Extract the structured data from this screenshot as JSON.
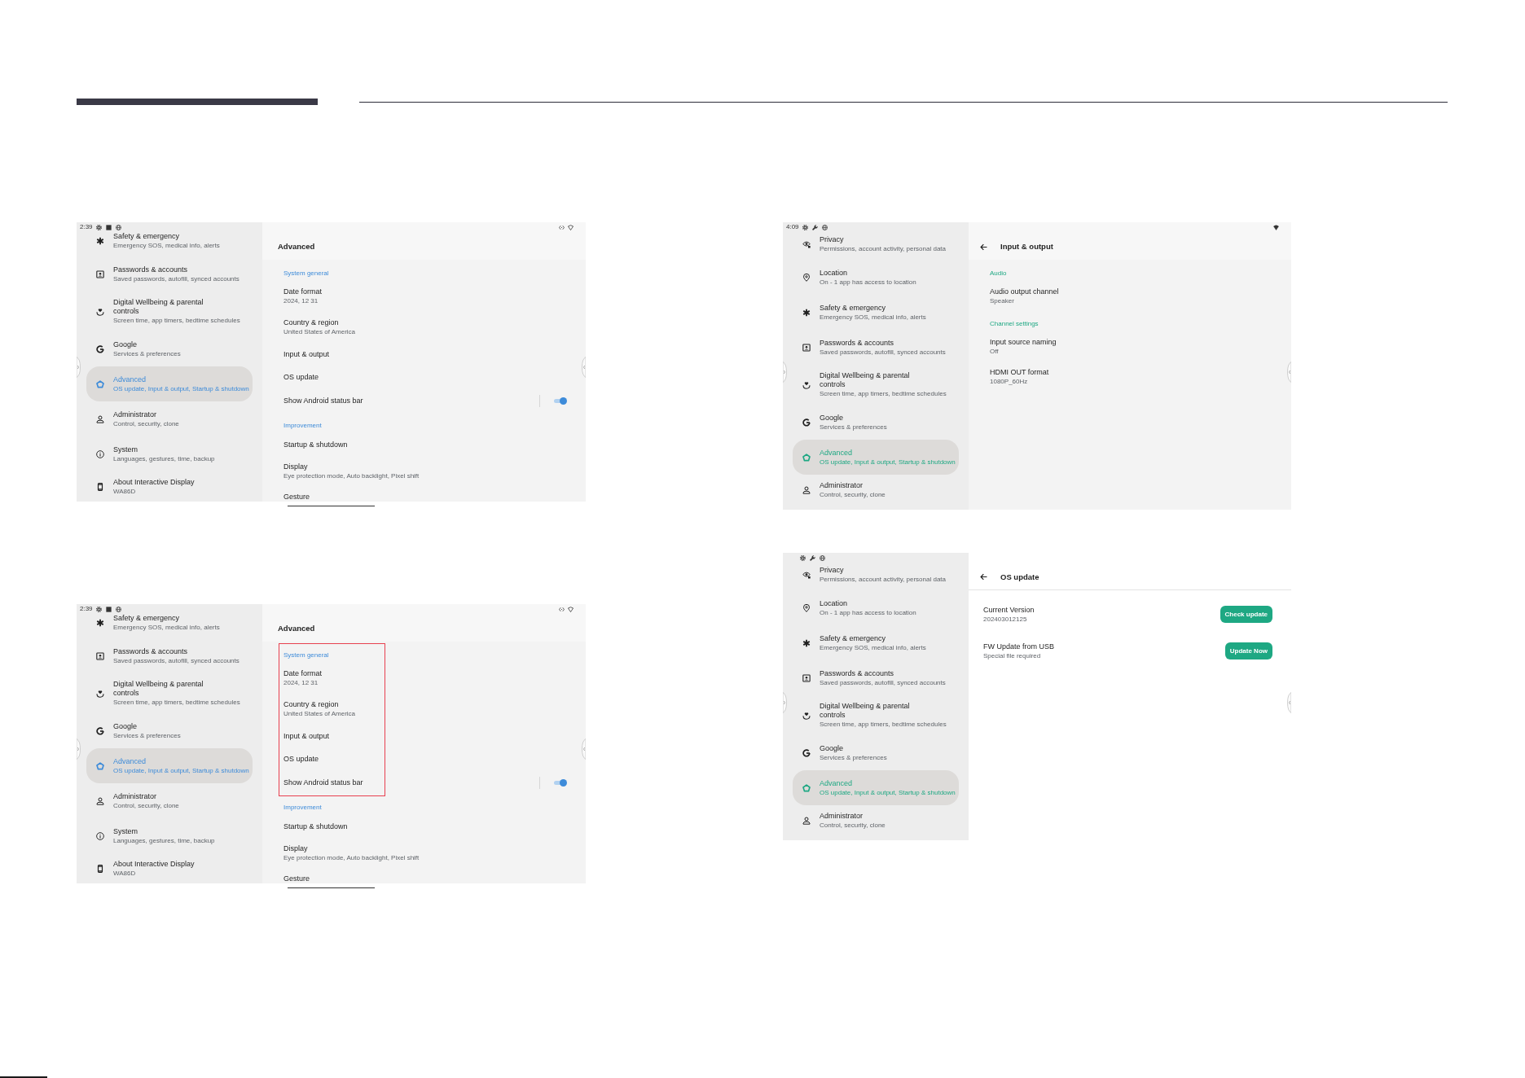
{
  "columns": [
    {
      "screens": [
        {
          "color": "#3d8bd9",
          "status_bar": {
            "time": "2:39",
            "left_icons": [
              {
                "kind": "gear"
              },
              {
                "kind": "square"
              },
              {
                "kind": "globe"
              }
            ],
            "right_icons": [
              {
                "kind": "code"
              },
              {
                "kind": "wifi-outline"
              }
            ]
          },
          "sidebar": [
            {
              "kind": "safety",
              "title": "Safety & emergency",
              "subtitle": "Emergency SOS, medical info, alerts",
              "selected": false
            },
            {
              "kind": "passwords",
              "title": "Passwords & accounts",
              "subtitle": "Saved passwords, autofill, synced accounts",
              "selected": false
            },
            {
              "kind": "wellbeing",
              "title": "Digital Wellbeing & parental controls",
              "subtitle": "Screen time, app timers, bedtime schedules",
              "selected": false
            },
            {
              "kind": "google",
              "title": "Google",
              "subtitle": "Services & preferences",
              "selected": false
            },
            {
              "kind": "advanced",
              "title": "Advanced",
              "subtitle": "OS update, Input & output, Startup & shutdown",
              "selected": true
            },
            {
              "kind": "administrator",
              "title": "Administrator",
              "subtitle": "Control, security, clone",
              "selected": false
            },
            {
              "kind": "system",
              "title": "System",
              "subtitle": "Languages, gestures, time, backup",
              "selected": false
            },
            {
              "kind": "about",
              "title": "About Interactive Display",
              "subtitle": "WA86D",
              "selected": false
            }
          ],
          "pane": {
            "kind": "list",
            "title": "Advanced",
            "groups": [
              {
                "label": "System general",
                "rows": [
                  {
                    "kind": "entry",
                    "title": "Date format",
                    "subtitle": "2024, 12 31"
                  },
                  {
                    "kind": "entry",
                    "title": "Country & region",
                    "subtitle": "United States of America"
                  },
                  {
                    "kind": "entry",
                    "title": "Input & output"
                  },
                  {
                    "kind": "entry",
                    "title": "OS update"
                  },
                  {
                    "kind": "toggle",
                    "title": "Show Android status bar",
                    "on": true
                  }
                ]
              },
              {
                "label": "Improvement",
                "rows": [
                  {
                    "kind": "entry",
                    "title": "Startup & shutdown"
                  },
                  {
                    "kind": "entry",
                    "title": "Display",
                    "subtitle": "Eye protection mode, Auto backlight, Pixel shift"
                  },
                  {
                    "kind": "entry",
                    "title": "Gesture"
                  }
                ]
              }
            ]
          }
        },
        {
          "color": "#3d8bd9",
          "status_bar": {
            "time": "2:39",
            "left_icons": [
              {
                "kind": "gear"
              },
              {
                "kind": "square"
              },
              {
                "kind": "globe"
              }
            ],
            "right_icons": [
              {
                "kind": "code"
              },
              {
                "kind": "wifi-outline"
              }
            ]
          },
          "sidebar": [
            {
              "kind": "safety",
              "title": "Safety & emergency",
              "subtitle": "Emergency SOS, medical info, alerts",
              "selected": false
            },
            {
              "kind": "passwords",
              "title": "Passwords & accounts",
              "subtitle": "Saved passwords, autofill, synced accounts",
              "selected": false
            },
            {
              "kind": "wellbeing",
              "title": "Digital Wellbeing & parental controls",
              "subtitle": "Screen time, app timers, bedtime schedules",
              "selected": false
            },
            {
              "kind": "google",
              "title": "Google",
              "subtitle": "Services & preferences",
              "selected": false
            },
            {
              "kind": "advanced",
              "title": "Advanced",
              "subtitle": "OS update, Input & output, Startup & shutdown",
              "selected": true
            },
            {
              "kind": "administrator",
              "title": "Administrator",
              "subtitle": "Control, security, clone",
              "selected": false
            },
            {
              "kind": "system",
              "title": "System",
              "subtitle": "Languages, gestures, time, backup",
              "selected": false
            },
            {
              "kind": "about",
              "title": "About Interactive Display",
              "subtitle": "WA86D",
              "selected": false
            }
          ],
          "pane": {
            "kind": "list",
            "title": "Advanced",
            "groups": [
              {
                "label": "System general",
                "highlighted": true,
                "rows": [
                  {
                    "kind": "entry",
                    "title": "Date format",
                    "subtitle": "2024, 12 31"
                  },
                  {
                    "kind": "entry",
                    "title": "Country & region",
                    "subtitle": "United States of America"
                  },
                  {
                    "kind": "entry",
                    "title": "Input & output"
                  },
                  {
                    "kind": "entry",
                    "title": "OS update"
                  },
                  {
                    "kind": "toggle",
                    "title": "Show Android status bar",
                    "on": true
                  }
                ]
              },
              {
                "label": "Improvement",
                "rows": [
                  {
                    "kind": "entry",
                    "title": "Startup & shutdown"
                  },
                  {
                    "kind": "entry",
                    "title": "Display",
                    "subtitle": "Eye protection mode, Auto backlight, Pixel shift"
                  },
                  {
                    "kind": "entry",
                    "title": "Gesture"
                  }
                ]
              }
            ]
          }
        }
      ]
    },
    {
      "screens": [
        {
          "color": "#1ea883",
          "status_bar": {
            "time": "4:09",
            "left_icons": [
              {
                "kind": "gear"
              },
              {
                "kind": "wrench"
              },
              {
                "kind": "globe"
              }
            ],
            "right_icons": [
              {
                "kind": "wifi-full"
              }
            ]
          },
          "sidebar": [
            {
              "kind": "privacy",
              "title": "Privacy",
              "subtitle": "Permissions, account activity, personal data",
              "selected": false
            },
            {
              "kind": "location",
              "title": "Location",
              "subtitle": "On - 1 app has access to location",
              "selected": false
            },
            {
              "kind": "safety",
              "title": "Safety & emergency",
              "subtitle": "Emergency SOS, medical info, alerts",
              "selected": false
            },
            {
              "kind": "passwords",
              "title": "Passwords & accounts",
              "subtitle": "Saved passwords, autofill, synced accounts",
              "selected": false
            },
            {
              "kind": "wellbeing",
              "title": "Digital Wellbeing & parental controls",
              "subtitle": "Screen time, app timers, bedtime schedules",
              "selected": false
            },
            {
              "kind": "google",
              "title": "Google",
              "subtitle": "Services & preferences",
              "selected": false
            },
            {
              "kind": "advanced",
              "title": "Advanced",
              "subtitle": "OS update, Input & output, Startup & shutdown",
              "selected": true
            },
            {
              "kind": "administrator",
              "title": "Administrator",
              "subtitle": "Control, security, clone",
              "selected": false
            }
          ],
          "pane": {
            "kind": "list",
            "back": true,
            "title": "Input & output",
            "groups": [
              {
                "label": "Audio",
                "rows": [
                  {
                    "kind": "entry",
                    "title": "Audio output channel",
                    "subtitle": "Speaker"
                  }
                ]
              },
              {
                "label": "Channel settings",
                "rows": [
                  {
                    "kind": "entry",
                    "title": "Input source naming",
                    "subtitle": "Off"
                  },
                  {
                    "kind": "entry",
                    "title": "HDMI OUT format",
                    "subtitle": "1080P_60Hz"
                  }
                ]
              }
            ]
          }
        },
        {
          "color": "#1ea883",
          "status_bar": {
            "left_icons": [
              {
                "kind": "gear"
              },
              {
                "kind": "wrench"
              },
              {
                "kind": "globe"
              }
            ]
          },
          "sidebar": [
            {
              "kind": "privacy",
              "title": "Privacy",
              "subtitle": "Permissions, account activity, personal data",
              "selected": false
            },
            {
              "kind": "location",
              "title": "Location",
              "subtitle": "On - 1 app has access to location",
              "selected": false
            },
            {
              "kind": "safety",
              "title": "Safety & emergency",
              "subtitle": "Emergency SOS, medical info, alerts",
              "selected": false
            },
            {
              "kind": "passwords",
              "title": "Passwords & accounts",
              "subtitle": "Saved passwords, autofill, synced accounts",
              "selected": false
            },
            {
              "kind": "wellbeing",
              "title": "Digital Wellbeing & parental controls",
              "subtitle": "Screen time, app timers, bedtime schedules",
              "selected": false
            },
            {
              "kind": "google",
              "title": "Google",
              "subtitle": "Services & preferences",
              "selected": false
            },
            {
              "kind": "advanced",
              "title": "Advanced",
              "subtitle": "OS update, Input & output, Startup & shutdown",
              "selected": true
            },
            {
              "kind": "administrator",
              "title": "Administrator",
              "subtitle": "Control, security, clone",
              "selected": false
            }
          ],
          "pane": {
            "kind": "form",
            "back": true,
            "title": "OS update",
            "groups": [
              {
                "rows": [
                  {
                    "kind": "button",
                    "title": "Current Version",
                    "subtitle": "202403012125",
                    "button": "Check update"
                  },
                  {
                    "kind": "button",
                    "title": "FW Update from USB",
                    "subtitle": "Special file required",
                    "button": "Update Now"
                  }
                ]
              }
            ]
          }
        }
      ]
    }
  ]
}
